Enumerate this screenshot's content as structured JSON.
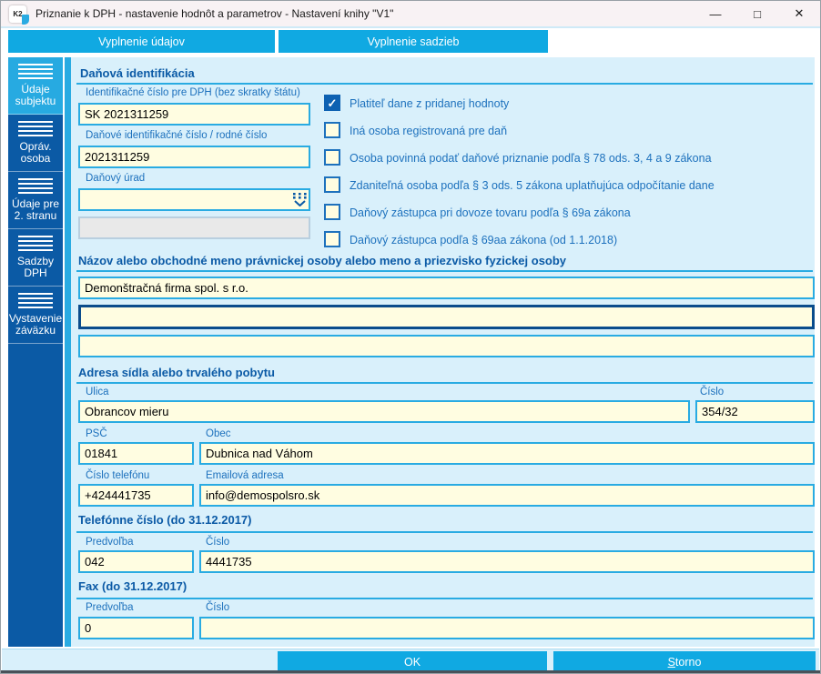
{
  "window": {
    "title": "Priznanie k DPH - nastavenie hodnôt a parametrov - Nastavení knihy \"V1\"",
    "app_icon_text": "K2",
    "controls": {
      "minimize": "—",
      "maximize": "□",
      "close": "✕"
    }
  },
  "icons": {
    "check": "✓"
  },
  "colors": {
    "accent_cyan": "#10a9e2",
    "sidebar_blue": "#0b5aa5",
    "sidebar_active": "#27aae1",
    "panel_bg": "#d9f0fb",
    "input_bg": "#fffde1",
    "input_border": "#29abe2",
    "focused_border": "#0a4c8c",
    "heading_blue": "#0b5aa6",
    "label_blue": "#1d71bd"
  },
  "tabs": [
    {
      "label": "Vyplnenie údajov"
    },
    {
      "label": "Vyplnenie sadzieb"
    }
  ],
  "sidebar": {
    "items": [
      {
        "label": "Údaje subjektu",
        "active": true
      },
      {
        "label": "Opráv. osoba",
        "active": false
      },
      {
        "label": "Údaje pre 2. stranu",
        "active": false
      },
      {
        "label": "Sadzby DPH",
        "active": false
      },
      {
        "label": "Vystavenie záväzku",
        "active": false
      }
    ]
  },
  "sections": {
    "tax_id": {
      "title": "Daňová identifikácia",
      "fields": {
        "vat_id": {
          "label": "Identifikačné číslo pre DPH (bez skratky štátu)",
          "value": "SK 2021311259"
        },
        "tax_number": {
          "label": "Daňové identifikačné číslo / rodné číslo",
          "value": "2021311259"
        },
        "tax_office": {
          "label": "Daňový úrad",
          "value": ""
        },
        "tax_office_detail": {
          "value": ""
        }
      },
      "checkboxes": [
        {
          "label": "Platiteľ dane z pridanej hodnoty",
          "checked": true
        },
        {
          "label": "Iná osoba registrovaná pre daň",
          "checked": false
        },
        {
          "label": "Osoba povinná podať daňové priznanie podľa § 78 ods. 3, 4 a 9 zákona",
          "checked": false
        },
        {
          "label": "Zdaniteľná osoba podľa § 3 ods. 5 zákona uplatňujúca odpočítanie dane",
          "checked": false
        },
        {
          "label": "Daňový zástupca pri dovoze tovaru podľa § 69a zákona",
          "checked": false
        },
        {
          "label": "Daňový zástupca podľa § 69aa zákona (od 1.1.2018)",
          "checked": false
        }
      ]
    },
    "name": {
      "title": "Názov alebo obchodné meno právnickej osoby alebo meno a priezvisko fyzickej osoby",
      "line1": "Demonštračná firma spol. s r.o.",
      "line2": "",
      "line3": ""
    },
    "address": {
      "title": "Adresa sídla alebo trvalého pobytu",
      "street": {
        "label": "Ulica",
        "value": "Obrancov mieru"
      },
      "number": {
        "label": "Číslo",
        "value": "354/32"
      },
      "zip": {
        "label": "PSČ",
        "value": "01841"
      },
      "city": {
        "label": "Obec",
        "value": "Dubnica nad Váhom"
      },
      "phone": {
        "label": "Číslo telefónu",
        "value": "+424441735"
      },
      "email": {
        "label": "Emailová adresa",
        "value": "info@demospolsro.sk"
      }
    },
    "phone2017": {
      "title": "Telefónne číslo (do 31.12.2017)",
      "prefix": {
        "label": "Predvoľba",
        "value": "042"
      },
      "number": {
        "label": "Číslo",
        "value": "4441735"
      }
    },
    "fax2017": {
      "title": "Fax (do 31.12.2017)",
      "prefix": {
        "label": "Predvoľba",
        "value": "0"
      },
      "number": {
        "label": "Číslo",
        "value": ""
      }
    }
  },
  "footer": {
    "ok": "OK",
    "cancel_first": "S",
    "cancel_rest": "torno"
  }
}
